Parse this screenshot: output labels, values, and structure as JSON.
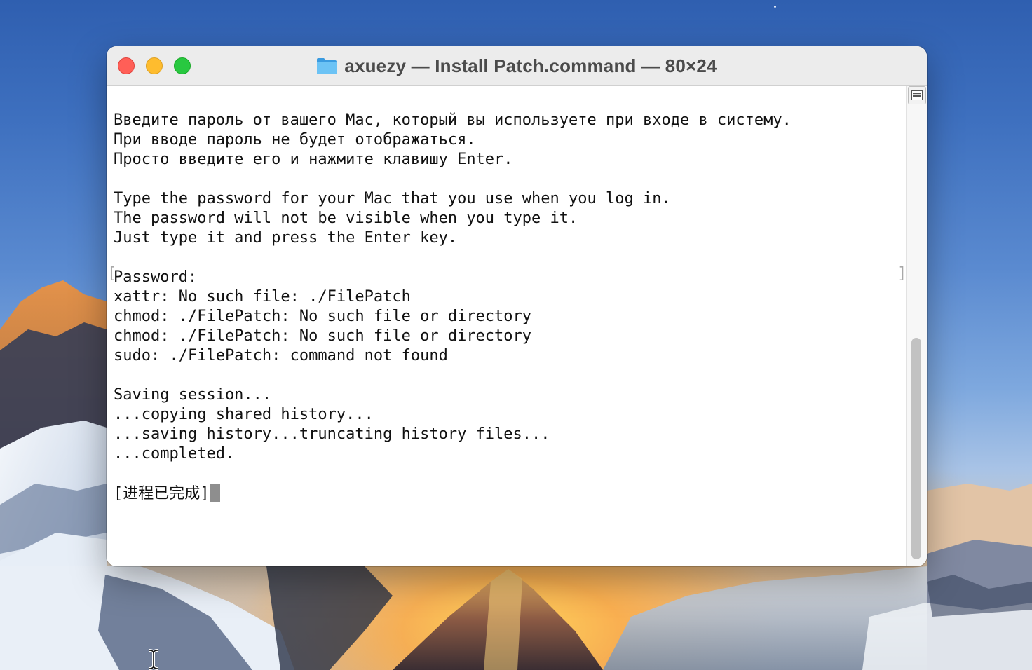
{
  "window": {
    "title": "axuezy — Install Patch.command — 80×24",
    "title_icon": "folder-icon",
    "controls": [
      "close",
      "minimize",
      "zoom"
    ]
  },
  "terminal": {
    "lines": [
      "Введите пароль от вашего Mac, который вы используете при входе в систему.",
      "При вводе пароль не будет отображаться.",
      "Просто введите его и нажмите клавишу Enter.",
      "",
      "Type the password for your Mac that you use when you log in.",
      "The password will not be visible when you type it.",
      "Just type it and press the Enter key.",
      "",
      "Password:",
      "xattr: No such file: ./FilePatch",
      "chmod: ./FilePatch: No such file or directory",
      "chmod: ./FilePatch: No such file or directory",
      "sudo: ./FilePatch: command not found",
      "",
      "Saving session...",
      "...copying shared history...",
      "...saving history...truncating history files...",
      "...completed.",
      "",
      "[进程已完成]"
    ],
    "mark_left": "[",
    "mark_right": "]",
    "cursor": "block"
  },
  "scrollbar": {
    "split_button_icon": "split-view-icon"
  },
  "colors": {
    "close": "#ff5f57",
    "minimize": "#febc2e",
    "zoom": "#28c840",
    "folder": "#5fb7f0",
    "cursor": "#8e8e8e"
  }
}
